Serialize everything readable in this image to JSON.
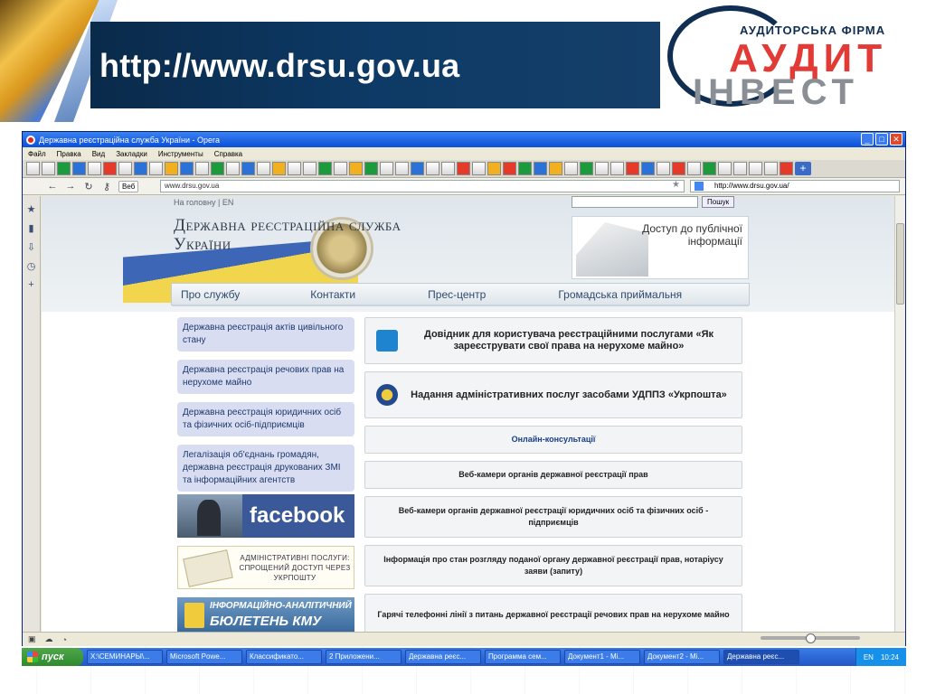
{
  "slide": {
    "banner_text": "http://www.drsu.gov.ua",
    "logo": {
      "top": "АУДИТОРСЬКА ФІРМА",
      "mid": "АУДИТ",
      "bot": "ІНВЕСТ"
    }
  },
  "browser": {
    "title": "Державна реєстраційна служба України - Opera",
    "menu": [
      "Файл",
      "Правка",
      "Вид",
      "Закладки",
      "Инструменты",
      "Справка"
    ],
    "web_button": "Веб",
    "url": "www.drsu.gov.ua",
    "search_value": "http://www.drsu.gov.ua/"
  },
  "site": {
    "toplinks": "На головну | EN",
    "search_button": "Пошук",
    "name_line1": "Державна реєстраційна служба",
    "name_line2": "України",
    "access_text": "Доступ до публічної інформації",
    "nav": [
      "Про службу",
      "Контакти",
      "Прес-центр",
      "Громадська приймальня"
    ],
    "left_links": [
      "Державна реєстрація актів цивільного стану",
      "Державна реєстрація речових прав на нерухоме майно",
      "Державна реєстрація юридичних осіб та фізичних осіб-підприємців",
      "Легалізація об'єднань громадян, державна реєстрація друкованих ЗМІ та інформаційних агентств"
    ],
    "facebook": "facebook",
    "admin_banner": "АДМІНІСТРАТИВНІ ПОСЛУГИ: СПРОЩЕНИЙ ДОСТУП ЧЕРЕЗ УКРПОШТУ",
    "kmu_line1": "ІНФОРМАЦІЙНО-АНАЛІТИЧНИЙ",
    "kmu_line2": "БЮЛЕТЕНЬ КМУ",
    "right_boxes": {
      "guide": "Довідник для користувача реєстраційними послугами «Як зареєструвати свої права на нерухоме майно»",
      "ukrposhta": "Надання адміністративних послуг засобами УДППЗ «Укрпошта»",
      "consult": "Онлайн-консультації",
      "webcam_rights": "Веб-камери органів державної реєстрації прав",
      "webcam_legal": "Веб-камери органів державної реєстрації юридичних осіб та фізичних осіб - підприємців",
      "status_info": "Інформація про стан розгляду поданої органу державної реєстрації прав, нотаріусу заяви (запиту)",
      "hotline": "Гарячі телефонні лінії з питань державної реєстрації речових прав на нерухоме майно"
    }
  },
  "taskbar": {
    "start": "пуск",
    "tasks": [
      "X:\\СЕМИНАРЫ\\...",
      "Microsoft Powe...",
      "Классификато...",
      "2 Приложени...",
      "Державна реєс...",
      "Программа сем...",
      "Документ1 - Mi...",
      "Документ2 - Mi...",
      "Державна реєс..."
    ],
    "lang": "EN",
    "clock": "10:24"
  }
}
